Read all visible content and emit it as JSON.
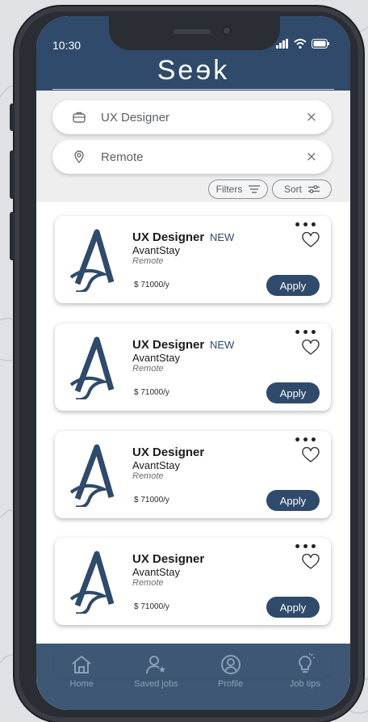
{
  "status_bar": {
    "time": "10:30"
  },
  "app": {
    "logo": "Seɘk"
  },
  "search": {
    "query": {
      "value": "UX Designer",
      "clear": "×"
    },
    "location": {
      "value": "Remote",
      "clear": "×"
    }
  },
  "controls": {
    "filters_label": "Filters",
    "sort_label": "Sort"
  },
  "jobs": [
    {
      "title": "UX Designer",
      "badge": "NEW",
      "company": "AvantStay",
      "location": "Remote",
      "salary": "$ 71000/y",
      "apply_label": "Apply",
      "more": "•••"
    },
    {
      "title": "UX Designer",
      "badge": "NEW",
      "company": "AvantStay",
      "location": "Remote",
      "salary": "$ 71000/y",
      "apply_label": "Apply",
      "more": "•••"
    },
    {
      "title": "UX Designer",
      "badge": "",
      "company": "AvantStay",
      "location": "Remote",
      "salary": "$ 71000/y",
      "apply_label": "Apply",
      "more": "•••"
    },
    {
      "title": "UX Designer",
      "badge": "",
      "company": "AvantStay",
      "location": "Remote",
      "salary": "$ 71000/y",
      "apply_label": "Apply",
      "more": "•••"
    }
  ],
  "tabs": [
    {
      "label": "Home",
      "icon": "home-icon"
    },
    {
      "label": "Saved jobs",
      "icon": "saved-jobs-icon"
    },
    {
      "label": "Profile",
      "icon": "profile-icon"
    },
    {
      "label": "Job tips",
      "icon": "lightbulb-icon"
    }
  ],
  "colors": {
    "brand": "#2f4a6a",
    "accent_text": "#2f4a6a",
    "tab_inactive": "#8aa0b8"
  }
}
